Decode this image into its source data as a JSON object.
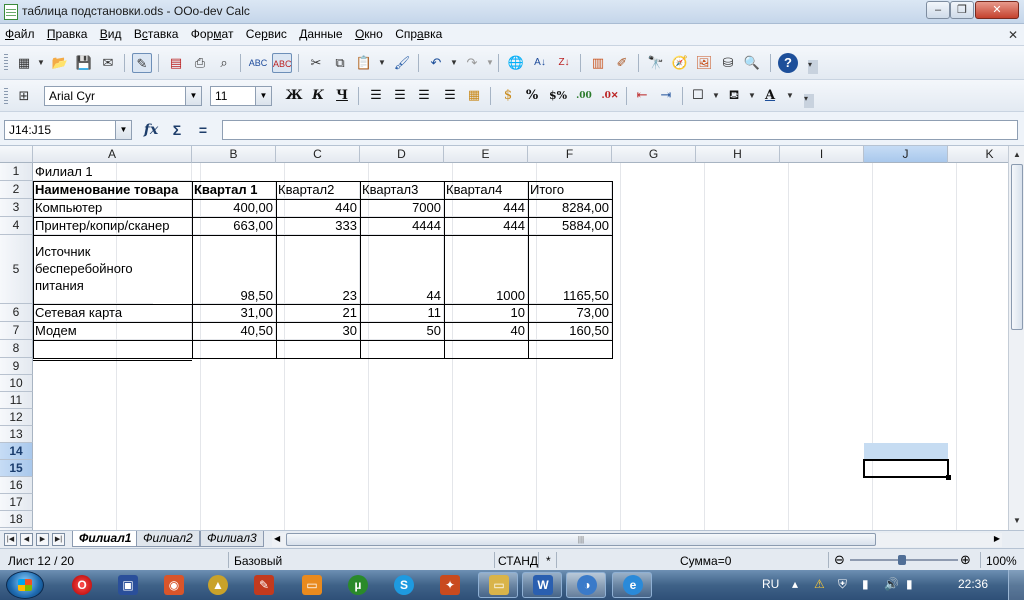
{
  "window": {
    "title": "таблица подстановки.ods - OOo-dev Calc",
    "minimize": "–",
    "maximize": "❐",
    "close": "✕"
  },
  "menu": {
    "items": [
      {
        "label": "Файл",
        "ul": "Ф",
        "rest": "айл"
      },
      {
        "label": "Правка",
        "ul": "П",
        "rest": "равка"
      },
      {
        "label": "Вид",
        "ul": "В",
        "rest": "ид"
      },
      {
        "label": "Вставка",
        "ul": "",
        "pre": "В",
        "mid": "с",
        "rest": "тавка"
      },
      {
        "label": "Формат",
        "ul": "",
        "pre": "Фор",
        "mid": "м",
        "rest": "ат"
      },
      {
        "label": "Сервис",
        "ul": "",
        "pre": "Се",
        "mid": "р",
        "rest": "вис"
      },
      {
        "label": "Данные",
        "ul": "Д",
        "rest": "анные"
      },
      {
        "label": "Окно",
        "ul": "О",
        "rest": "кно"
      },
      {
        "label": "Справка",
        "ul": "",
        "pre": "Спр",
        "mid": "а",
        "rest": "вка"
      }
    ],
    "close_doc": "✕"
  },
  "format_toolbar": {
    "font_name": "Arial Cyr",
    "font_size": "11",
    "bold": "Ж",
    "italic": "К",
    "underline": "Ч"
  },
  "formula_bar": {
    "name_box": "J14:J15",
    "fx": "fx",
    "sum": "Σ",
    "equals": "=",
    "value": ""
  },
  "columns": [
    "A",
    "B",
    "C",
    "D",
    "E",
    "F",
    "G",
    "H",
    "I",
    "J",
    "K"
  ],
  "rows": [
    "1",
    "2",
    "3",
    "4",
    "5",
    "6",
    "7",
    "8",
    "9",
    "10",
    "11",
    "12",
    "13",
    "14",
    "15",
    "16",
    "17",
    "18"
  ],
  "sheet": {
    "title": "Филиал 1",
    "headers": [
      "Наименование товара",
      "Квартал 1",
      "Квартал2",
      "Квартал3",
      "Квартал4",
      "Итого"
    ],
    "data": [
      [
        "Компьютер",
        "400,00",
        "440",
        "7000",
        "444",
        "8284,00"
      ],
      [
        "Принтер/копир/сканер",
        "663,00",
        "333",
        "4444",
        "444",
        "5884,00"
      ],
      [
        "Источник бесперебойного питания",
        "98,50",
        "23",
        "44",
        "1000",
        "1165,50"
      ],
      [
        "Сетевая карта",
        "31,00",
        "21",
        "11",
        "10",
        "73,00"
      ],
      [
        "Модем",
        "40,50",
        "30",
        "50",
        "40",
        "160,50"
      ]
    ],
    "selection": "J14:J15"
  },
  "tabs": {
    "sheets": [
      "Филиал1",
      "Филиал2",
      "Филиал3"
    ],
    "active": "Филиал1",
    "hscroll_grip": "|||"
  },
  "status": {
    "sheet": "Лист 12 / 20",
    "page_style": "Базовый",
    "mode": "СТАНД",
    "modified": "*",
    "sum": "Сумма=0",
    "zoom": "100%",
    "zoom_minus": "⊖",
    "zoom_plus": "⊕"
  },
  "taskbar": {
    "lang": "RU",
    "time": "22:36"
  },
  "colors": {
    "selection_fill": "#c6dcf2",
    "header_selected": "#a9c8ec"
  }
}
